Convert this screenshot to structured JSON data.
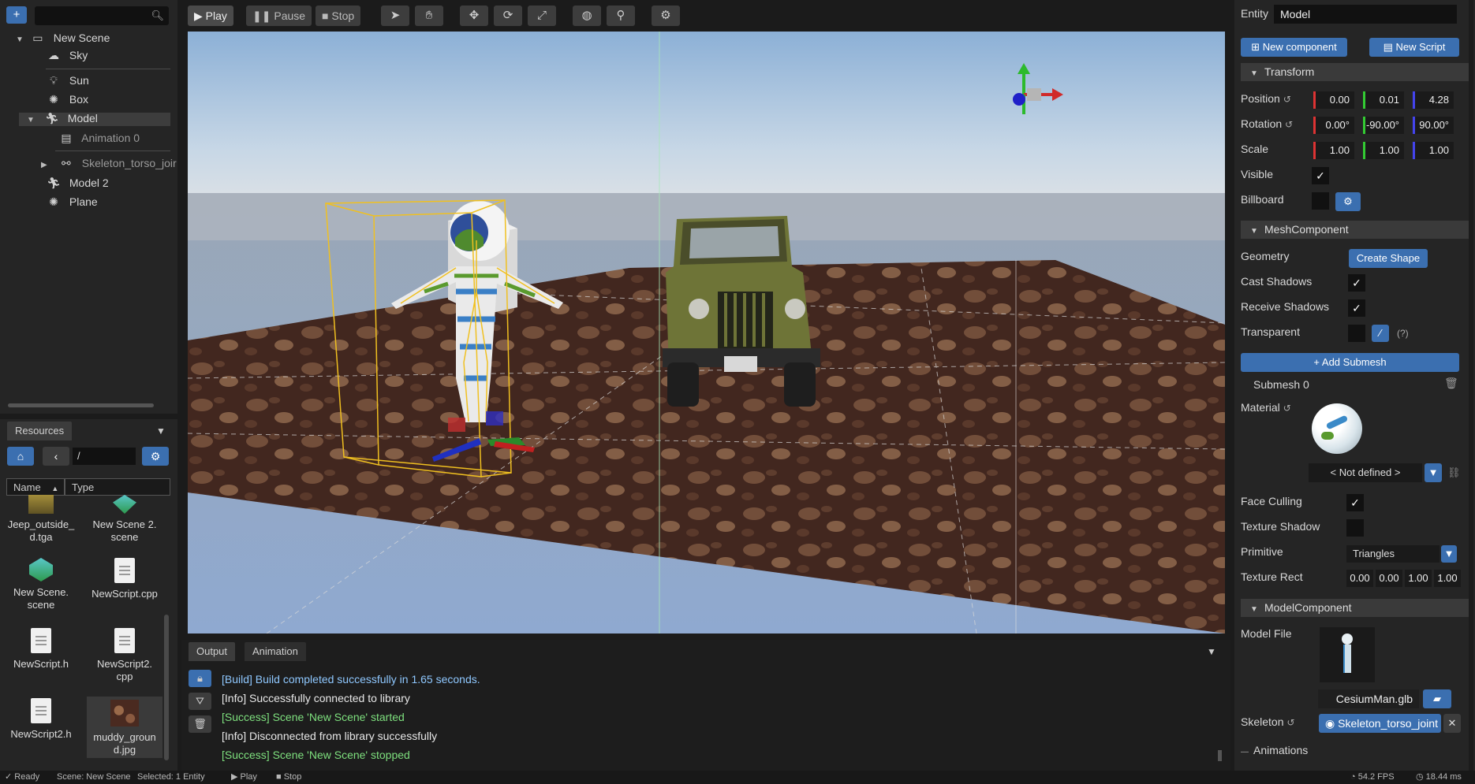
{
  "tree": {
    "add_label": "+",
    "items": [
      {
        "label": "New Scene",
        "icon": "monitor-icon"
      },
      {
        "label": "Sky",
        "icon": "cloud-icon"
      },
      {
        "label": "Sun",
        "icon": "bulb-icon"
      },
      {
        "label": "Box",
        "icon": "shape-icon"
      },
      {
        "label": "Model",
        "icon": "figure-icon"
      },
      {
        "label": "Animation 0",
        "icon": "film-icon"
      },
      {
        "label": "Skeleton_torso_joir",
        "icon": "bone-icon"
      },
      {
        "label": "Model 2",
        "icon": "figure-icon"
      },
      {
        "label": "Plane",
        "icon": "shape-icon"
      }
    ]
  },
  "resources": {
    "tab": "Resources",
    "path": "/",
    "columns": [
      "Name",
      "Type"
    ],
    "files": [
      {
        "name": "Jeep_outside_\nd.tga",
        "kind": "image"
      },
      {
        "name": "New Scene 2.\nscene",
        "kind": "scene"
      },
      {
        "name": "New Scene.\nscene",
        "kind": "scene"
      },
      {
        "name": "NewScript.cpp",
        "kind": "doc"
      },
      {
        "name": "NewScript.h",
        "kind": "doc"
      },
      {
        "name": "NewScript2.\ncpp",
        "kind": "doc"
      },
      {
        "name": "NewScript2.h",
        "kind": "doc"
      },
      {
        "name": "muddy_groun\nd.jpg",
        "kind": "texture"
      }
    ]
  },
  "toolbar": {
    "play": "Play",
    "pause": "Pause",
    "stop": "Stop"
  },
  "output": {
    "tabs": [
      "Output",
      "Animation"
    ],
    "lines": [
      {
        "text": "[Build] Build completed successfully in 1.65 seconds.",
        "color": "#8fc8ff"
      },
      {
        "text": "[Info] Successfully connected to library",
        "color": "#e8e8e8"
      },
      {
        "text": "[Success] Scene 'New Scene' started",
        "color": "#7ee07e"
      },
      {
        "text": "[Info] Disconnected from library successfully",
        "color": "#e8e8e8"
      },
      {
        "text": "[Success] Scene 'New Scene' stopped",
        "color": "#7ee07e"
      }
    ]
  },
  "inspector": {
    "entity_label": "Entity",
    "entity_value": "Model",
    "new_component": "New component",
    "new_script": "New Script",
    "transform": {
      "title": "Transform",
      "position_label": "Position",
      "position": [
        "0.00",
        "0.01",
        "4.28"
      ],
      "rotation_label": "Rotation",
      "rotation": [
        "0.00°",
        "-90.00°",
        "90.00°"
      ],
      "scale_label": "Scale",
      "scale": [
        "1.00",
        "1.00",
        "1.00"
      ],
      "visible_label": "Visible",
      "billboard_label": "Billboard"
    },
    "mesh": {
      "title": "MeshComponent",
      "geometry_label": "Geometry",
      "create_shape": "Create Shape",
      "cast_shadows_label": "Cast Shadows",
      "receive_shadows_label": "Receive Shadows",
      "transparent_label": "Transparent",
      "help": "(?)",
      "add_submesh": "+ Add Submesh",
      "submesh_label": "Submesh 0",
      "material_label": "Material",
      "material_value": "< Not defined >",
      "face_culling_label": "Face Culling",
      "texture_shadow_label": "Texture Shadow",
      "primitive_label": "Primitive",
      "primitive_value": "Triangles",
      "texture_rect_label": "Texture Rect",
      "texture_rect": [
        "0.00",
        "0.00",
        "1.00",
        "1.00"
      ]
    },
    "model": {
      "title": "ModelComponent",
      "model_file_label": "Model File",
      "model_file": "CesiumMan.glb",
      "skeleton_label": "Skeleton",
      "skeleton_value": "Skeleton_torso_joint",
      "animations_label": "Animations"
    }
  },
  "status": {
    "ready": "Ready",
    "scene": "Scene: New Scene",
    "selected": "Selected: 1 Entity",
    "play": "Play",
    "stop": "Stop",
    "fps": "54.2 FPS",
    "ms": "18.44 ms"
  }
}
